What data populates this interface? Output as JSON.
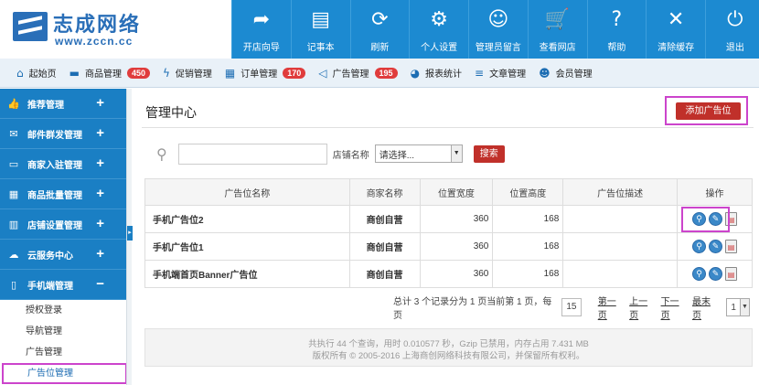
{
  "brand": {
    "name": "志成网络",
    "url": "www.zccn.cc"
  },
  "top_nav": [
    {
      "label": "开店向导",
      "icon": "arrow-forward-icon",
      "glyph": "➦"
    },
    {
      "label": "记事本",
      "icon": "notepad-icon",
      "glyph": "▤"
    },
    {
      "label": "刷新",
      "icon": "refresh-icon",
      "glyph": "⟳"
    },
    {
      "label": "个人设置",
      "icon": "gear-icon",
      "glyph": "⚙"
    },
    {
      "label": "管理员留言",
      "icon": "smiley-icon",
      "glyph": "☺"
    },
    {
      "label": "查看网店",
      "icon": "cart-icon",
      "glyph": "🛒"
    },
    {
      "label": "帮助",
      "icon": "help-icon",
      "glyph": "?"
    },
    {
      "label": "清除缓存",
      "icon": "close-circle-icon",
      "glyph": "✕"
    },
    {
      "label": "退出",
      "icon": "power-icon",
      "glyph": "⏻"
    }
  ],
  "nav2": [
    {
      "label": "起始页",
      "icon": "home-icon",
      "glyph": "⌂",
      "badge": ""
    },
    {
      "label": "商品管理",
      "icon": "folder-icon",
      "glyph": "▬",
      "badge": "450"
    },
    {
      "label": "促销管理",
      "icon": "bolt-icon",
      "glyph": "ϟ",
      "badge": ""
    },
    {
      "label": "订单管理",
      "icon": "order-icon",
      "glyph": "▦",
      "badge": "170"
    },
    {
      "label": "广告管理",
      "icon": "megaphone-icon",
      "glyph": "◁",
      "badge": "195"
    },
    {
      "label": "报表统计",
      "icon": "pie-icon",
      "glyph": "◕",
      "badge": ""
    },
    {
      "label": "文章管理",
      "icon": "list-icon",
      "glyph": "≡",
      "badge": ""
    },
    {
      "label": "会员管理",
      "icon": "users-icon",
      "glyph": "☻",
      "badge": ""
    }
  ],
  "sidebar": {
    "groups": [
      {
        "label": "推荐管理",
        "icon": "thumbs-up-icon",
        "glyph": "👍",
        "toggle": "+"
      },
      {
        "label": "邮件群发管理",
        "icon": "mail-icon",
        "glyph": "✉",
        "toggle": "+"
      },
      {
        "label": "商家入驻管理",
        "icon": "monitor-icon",
        "glyph": "▭",
        "toggle": "+"
      },
      {
        "label": "商品批量管理",
        "icon": "grid-icon",
        "glyph": "▦",
        "toggle": "+"
      },
      {
        "label": "店铺设置管理",
        "icon": "store-icon",
        "glyph": "▥",
        "toggle": "+"
      },
      {
        "label": "云服务中心",
        "icon": "cloud-icon",
        "glyph": "☁",
        "toggle": "+"
      },
      {
        "label": "手机端管理",
        "icon": "mobile-icon",
        "glyph": "▯",
        "toggle": "−"
      }
    ],
    "sub_items": [
      "授权登录",
      "导航管理",
      "广告管理",
      "广告位管理"
    ]
  },
  "main": {
    "title": "管理中心",
    "add_button": "添加广告位",
    "search": {
      "placeholder": "",
      "store_label": "店铺名称",
      "select_value": "请选择...",
      "button": "搜索"
    },
    "columns": [
      "广告位名称",
      "商家名称",
      "位置宽度",
      "位置高度",
      "广告位描述",
      "操作"
    ],
    "rows": [
      {
        "name": "手机广告位2",
        "merchant": "商创自营",
        "width": "360",
        "height": "168",
        "desc": ""
      },
      {
        "name": "手机广告位1",
        "merchant": "商创自营",
        "width": "360",
        "height": "168",
        "desc": ""
      },
      {
        "name": "手机端首页Banner广告位",
        "merchant": "商创自营",
        "width": "360",
        "height": "168",
        "desc": ""
      }
    ],
    "pager": {
      "summary": "总计 3 个记录分为 1 页当前第 1 页，每页",
      "per_page": "15",
      "first": "第一页",
      "prev": "上一页",
      "next": "下一页",
      "last": "最末页",
      "page_select": "1"
    }
  },
  "footer": {
    "line1": "共执行 44 个查询，用时 0.010577 秒，Gzip 已禁用，内存占用 7.431 MB",
    "line2": "版权所有 © 2005-2016 上海商创网络科技有限公司，并保留所有权利。"
  },
  "colors": {
    "header_blue": "#1c8ad1",
    "sidebar_blue": "#1a7fc4",
    "accent_red": "#c0302a",
    "highlight_magenta": "#cc44cc"
  }
}
